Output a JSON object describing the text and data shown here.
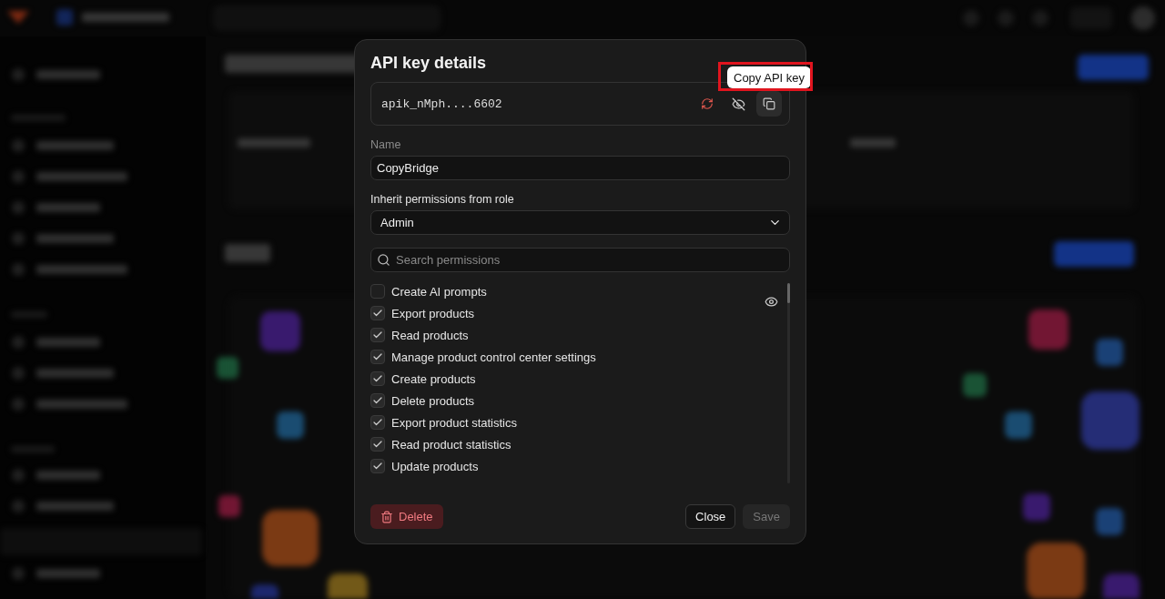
{
  "dialog": {
    "title": "API key details",
    "api_key": {
      "value": "apik_nMph....6602",
      "revealed": false
    },
    "tooltip": {
      "text": "Copy API key",
      "highlighted": true
    },
    "name_field": {
      "label": "Name",
      "value": "CopyBridge"
    },
    "role_select": {
      "label": "Inherit permissions from role",
      "value": "Admin"
    },
    "search": {
      "placeholder": "Search permissions"
    },
    "permissions": [
      {
        "label": "Create AI prompts",
        "checked": false
      },
      {
        "label": "Export products",
        "checked": true
      },
      {
        "label": "Read products",
        "checked": true
      },
      {
        "label": "Manage product control center settings",
        "checked": true
      },
      {
        "label": "Create products",
        "checked": true
      },
      {
        "label": "Delete products",
        "checked": true
      },
      {
        "label": "Export product statistics",
        "checked": true
      },
      {
        "label": "Read product statistics",
        "checked": true
      },
      {
        "label": "Update products",
        "checked": true
      }
    ],
    "buttons": [
      {
        "kind": "danger",
        "label": "Delete",
        "disabled": false
      },
      {
        "kind": "secondary",
        "label": "Close",
        "disabled": false
      },
      {
        "kind": "primary",
        "label": "Save",
        "disabled": true
      }
    ]
  }
}
